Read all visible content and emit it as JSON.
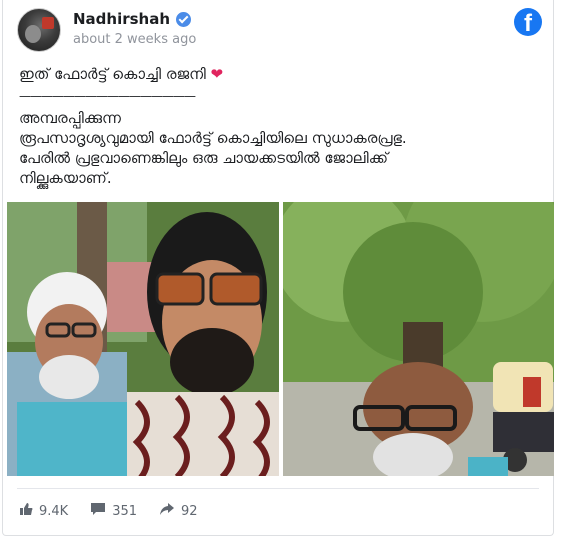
{
  "post": {
    "author": "Nadhirshah",
    "timestamp": "about 2 weeks ago",
    "line1": "ഇത് ഫോർട്ട് കൊച്ചി രജനി",
    "line1_emoji": "❤",
    "separator": "————————————————",
    "paragraph": "അമ്പരപ്പിക്കുന്ന\nരൂപസാദൃശ്യവുമായി ഫോർട്ട് കൊച്ചിയിലെ സുധാകരപ്രഭു.\nപേരിൽ പ്രഭുവാണെങ്കിലും ഒരു ചായക്കടയിൽ ജോലിക്ക്\nനില്ക്കുകയാണ്."
  },
  "stats": {
    "likes": "9.4K",
    "comments": "351",
    "shares": "92"
  },
  "icons": {
    "brand": "facebook-logo-icon",
    "verified": "verified-badge-icon",
    "like": "thumbs-up-icon",
    "comment": "comment-bubble-icon",
    "share": "share-arrow-icon"
  },
  "colors": {
    "facebook_blue": "#1877f2",
    "verified_blue": "#4b8ce8",
    "muted_text": "#90949c",
    "heart": "#e0245e"
  }
}
